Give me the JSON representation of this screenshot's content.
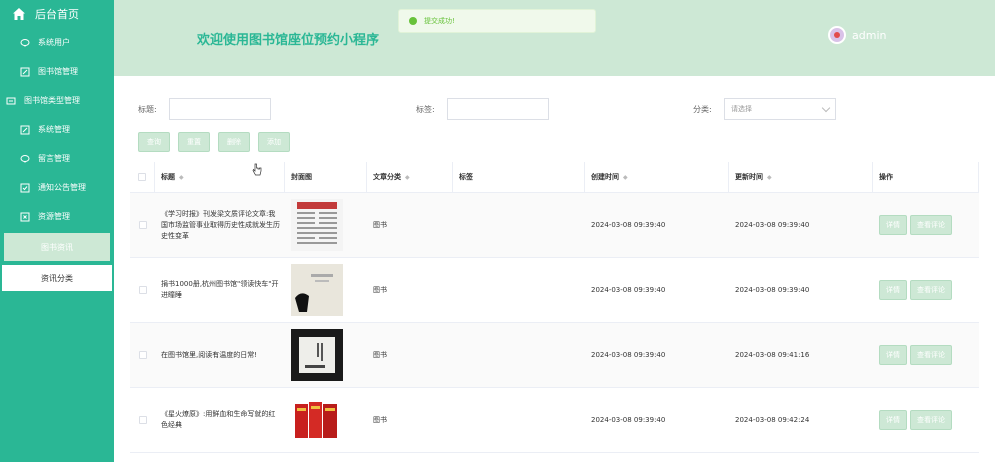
{
  "sidebar": {
    "home": "后台首页",
    "items": [
      "系统用户",
      "图书馆管理",
      "图书馆类型管理",
      "系统管理",
      "留言管理",
      "通知公告管理",
      "资源管理"
    ],
    "active_group": "图书资讯",
    "sub_item": "资讯分类"
  },
  "header": {
    "title": "欢迎使用图书馆座位预约小程序",
    "toast": "提交成功!",
    "user": "admin"
  },
  "search": {
    "title_label": "标题:",
    "title_value": "",
    "tag_label": "标签:",
    "tag_value": "",
    "category_label": "分类:",
    "category_placeholder": "请选择"
  },
  "buttons": {
    "query": "查询",
    "reset": "重置",
    "delete": "删除",
    "add": "添加"
  },
  "table": {
    "headers": [
      "标题",
      "封面图",
      "文章分类",
      "标签",
      "创建时间",
      "更新时间",
      "操作"
    ],
    "rows": [
      {
        "title": "《学习时报》刊发梁文质评论文章:我国市场监管事业取得历史性成就发生历史性变革",
        "category": "图书",
        "tag": "",
        "created": "2024-03-08 09:39:40",
        "updated": "2024-03-08 09:39:40"
      },
      {
        "title": "捐书1000册,杭州图书馆\"领读快车\"开进瞳睡",
        "category": "图书",
        "tag": "",
        "created": "2024-03-08 09:39:40",
        "updated": "2024-03-08 09:39:40"
      },
      {
        "title": "在图书馆里,阅读有温度的日常!",
        "category": "图书",
        "tag": "",
        "created": "2024-03-08 09:39:40",
        "updated": "2024-03-08 09:41:16"
      },
      {
        "title": "《星火燎原》:用鲜血和生命写就的红色经典",
        "category": "图书",
        "tag": "",
        "created": "2024-03-08 09:39:40",
        "updated": "2024-03-08 09:42:24"
      }
    ],
    "detail_label": "详情",
    "comment_label": "查看评论"
  },
  "colors": {
    "accent": "#2ab795",
    "header_bg": "#cde8d5",
    "success": "#67c23a"
  }
}
